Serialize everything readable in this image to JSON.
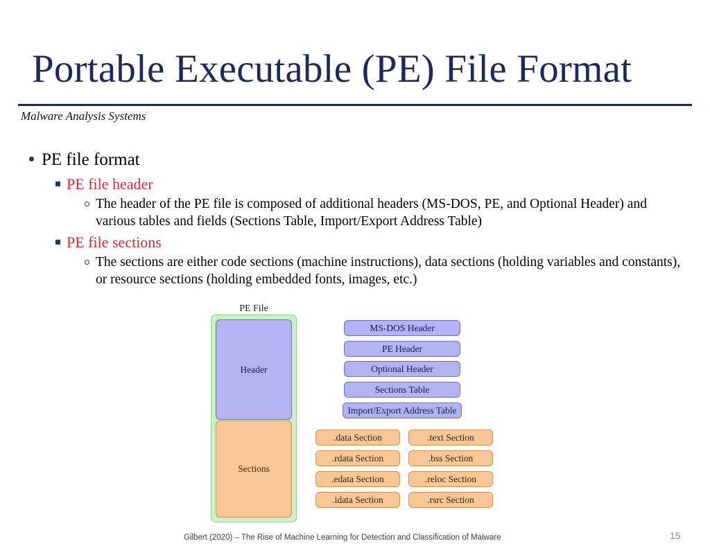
{
  "slide": {
    "title": "Portable Executable (PE) File Format",
    "subtitle": "Malware Analysis Systems",
    "page_number": "15",
    "footer_citation": "Gilbert (2020) – The Rise of Machine Learning for Detection and Classification of Malware"
  },
  "colors": {
    "title_navy": "#1b2a5e",
    "bullet_navy": "#1f3864",
    "heading_red": "#e8232a",
    "header_box_fill": "#b3b3f2",
    "header_box_border": "#6f6fc6",
    "section_box_fill": "#f8c795",
    "section_box_border": "#d39150",
    "container_fill": "#c9f2c5",
    "container_border": "#8fd38a",
    "footer_gray": "#3f3f3f",
    "page_number_gray": "#8d8d8d"
  },
  "bullets": {
    "l1_pe_file_format": "PE file format",
    "l2_pe_file_header": "PE file header",
    "l3_header_desc": "The header of the PE file is composed of additional headers (MS-DOS, PE, and Optional Header) and various tables and fields (Sections Table, Import/Export Address Table)",
    "l2_pe_file_sections": "PE file sections",
    "l3_sections_desc": "The sections are either code sections (machine instructions), data sections (holding variables and constants), or resource sections (holding embedded fonts, images, etc.)"
  },
  "diagram": {
    "container_label": "PE File",
    "block_header_label": "Header",
    "block_sections_label": "Sections",
    "header_parts": [
      {
        "label": "MS-DOS Header"
      },
      {
        "label": "PE Header"
      },
      {
        "label": "Optional Header"
      },
      {
        "label": "Sections Table"
      },
      {
        "label": "Import/Export Address Table"
      }
    ],
    "section_parts_left": [
      {
        "label": ".data Section"
      },
      {
        "label": ".rdata Section"
      },
      {
        "label": ".edata Section"
      },
      {
        "label": ".idata Section"
      }
    ],
    "section_parts_right": [
      {
        "label": ".text Section"
      },
      {
        "label": ".bss Section"
      },
      {
        "label": ".reloc Section"
      },
      {
        "label": ".rsrc Section"
      }
    ]
  }
}
